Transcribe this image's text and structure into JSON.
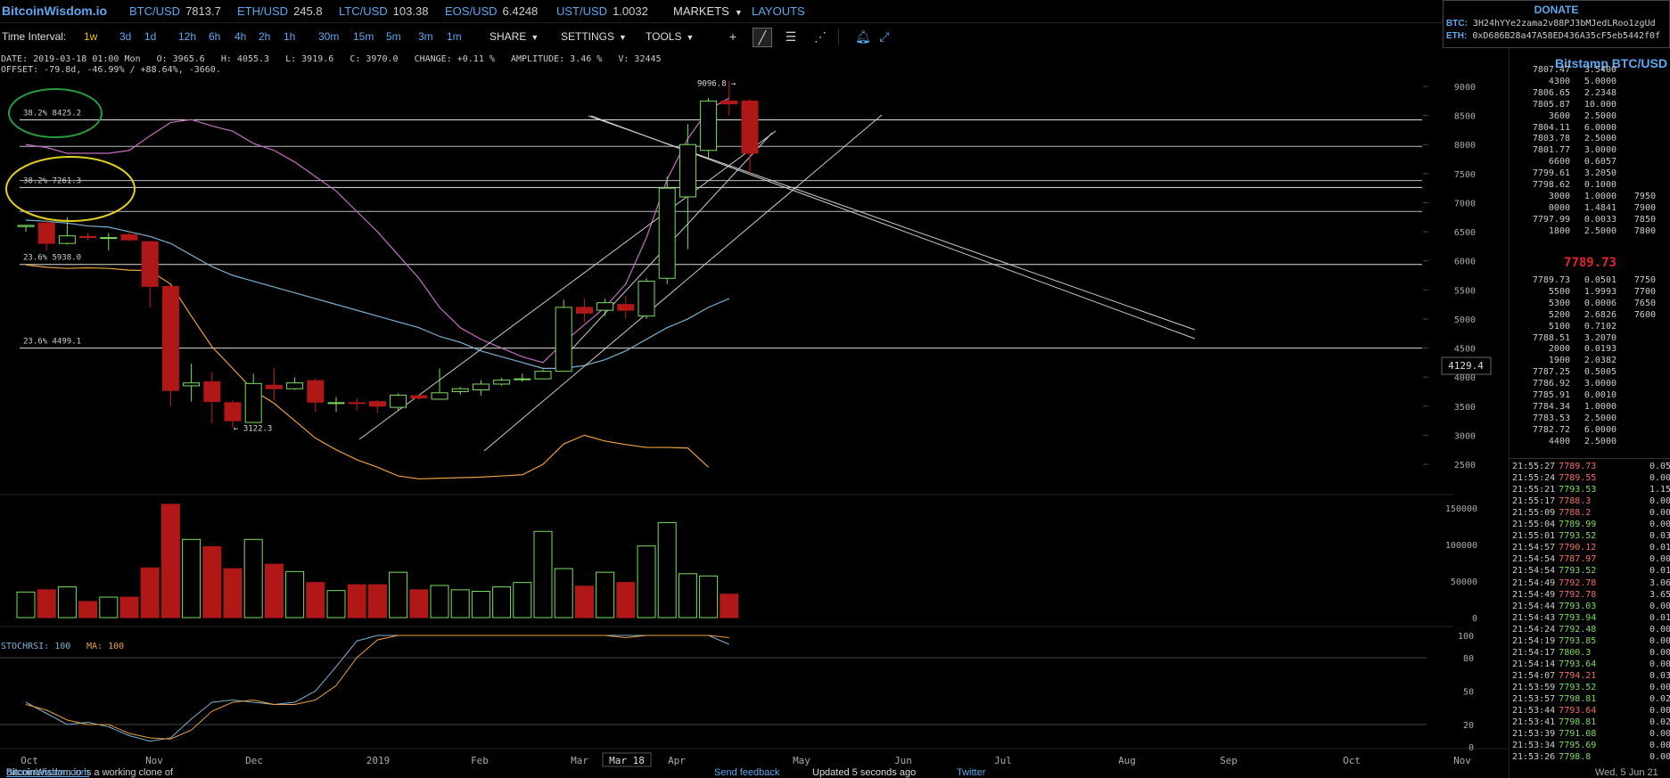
{
  "brand": "BitcoinWisdom.io",
  "tickers": [
    {
      "pair": "BTC/USD",
      "value": "7813.7"
    },
    {
      "pair": "ETH/USD",
      "value": "245.8"
    },
    {
      "pair": "LTC/USD",
      "value": "103.38"
    },
    {
      "pair": "EOS/USD",
      "value": "6.4248"
    },
    {
      "pair": "UST/USD",
      "value": "1.0032"
    }
  ],
  "nav": {
    "markets": "MARKETS",
    "layouts": "LAYOUTS"
  },
  "donate": {
    "title": "DONATE",
    "btc_label": "BTC:",
    "btc_addr": "3H24hYYe2zama2v88PJ3bMJedLRoo1zgUd",
    "eth_label": "ETH:",
    "eth_addr": "0xD686B28a47A58ED436A35cF5eb5442f0f"
  },
  "toolbar": {
    "interval_label": "Time Interval:",
    "intervals": [
      "1w",
      "3d",
      "1d",
      "12h",
      "6h",
      "4h",
      "2h",
      "1h",
      "30m",
      "15m",
      "5m",
      "3m",
      "1m"
    ],
    "active_interval": "1w",
    "share": "SHARE",
    "settings": "SETTINGS",
    "tools": "TOOLS"
  },
  "info": {
    "line1": "DATE: 2019-03-18 01:00 Mon   O: 3965.6   H: 4055.3   L: 3919.6   C: 3970.0   CHANGE: +0.11 %   AMPLITUDE: 3.46 %   V: 32445",
    "line2": "OFFSET: -79.8d, -46.99% / +88.64%, -3660."
  },
  "chart_data": {
    "type": "candlestick",
    "price_axis": [
      9000,
      8500,
      8000,
      7500,
      7000,
      6500,
      6000,
      5500,
      5000,
      4500,
      4000,
      3500,
      3000,
      2500
    ],
    "ylim": [
      2250,
      9350
    ],
    "months": [
      "Oct",
      "Nov",
      "Dec",
      "2019",
      "Feb",
      "Mar",
      "Mar 18",
      "Apr",
      "May",
      "Jun",
      "Jul",
      "Aug",
      "Sep",
      "Oct",
      "Nov"
    ],
    "candles": [
      {
        "o": 6590,
        "h": 6620,
        "l": 6500,
        "c": 6610
      },
      {
        "o": 6650,
        "h": 6720,
        "l": 6180,
        "c": 6300
      },
      {
        "o": 6300,
        "h": 6750,
        "l": 6280,
        "c": 6430
      },
      {
        "o": 6420,
        "h": 6480,
        "l": 6350,
        "c": 6400
      },
      {
        "o": 6400,
        "h": 6480,
        "l": 6180,
        "c": 6400
      },
      {
        "o": 6450,
        "h": 6500,
        "l": 6340,
        "c": 6360
      },
      {
        "o": 6330,
        "h": 6340,
        "l": 5200,
        "c": 5560
      },
      {
        "o": 5560,
        "h": 5580,
        "l": 3500,
        "c": 3770
      },
      {
        "o": 3850,
        "h": 4230,
        "l": 3580,
        "c": 3900
      },
      {
        "o": 3920,
        "h": 4080,
        "l": 3200,
        "c": 3580
      },
      {
        "o": 3560,
        "h": 3600,
        "l": 3130,
        "c": 3250
      },
      {
        "o": 3220,
        "h": 4060,
        "l": 3220,
        "c": 3890
      },
      {
        "o": 3860,
        "h": 4150,
        "l": 3600,
        "c": 3800
      },
      {
        "o": 3800,
        "h": 4000,
        "l": 3780,
        "c": 3900
      },
      {
        "o": 3940,
        "h": 3980,
        "l": 3400,
        "c": 3570
      },
      {
        "o": 3550,
        "h": 3660,
        "l": 3400,
        "c": 3560
      },
      {
        "o": 3560,
        "h": 3640,
        "l": 3420,
        "c": 3550
      },
      {
        "o": 3580,
        "h": 3600,
        "l": 3380,
        "c": 3500
      },
      {
        "o": 3480,
        "h": 3720,
        "l": 3420,
        "c": 3690
      },
      {
        "o": 3680,
        "h": 3700,
        "l": 3600,
        "c": 3640
      },
      {
        "o": 3620,
        "h": 4150,
        "l": 3620,
        "c": 3730
      },
      {
        "o": 3750,
        "h": 3830,
        "l": 3700,
        "c": 3800
      },
      {
        "o": 3780,
        "h": 3950,
        "l": 3680,
        "c": 3880
      },
      {
        "o": 3880,
        "h": 3990,
        "l": 3850,
        "c": 3950
      },
      {
        "o": 3960,
        "h": 4060,
        "l": 3920,
        "c": 3970
      },
      {
        "o": 3970,
        "h": 4130,
        "l": 3960,
        "c": 4100
      },
      {
        "o": 4100,
        "h": 5330,
        "l": 4100,
        "c": 5200
      },
      {
        "o": 5200,
        "h": 5350,
        "l": 4950,
        "c": 5100
      },
      {
        "o": 5150,
        "h": 5350,
        "l": 5050,
        "c": 5280
      },
      {
        "o": 5250,
        "h": 5400,
        "l": 5000,
        "c": 5150
      },
      {
        "o": 5050,
        "h": 5700,
        "l": 5000,
        "c": 5650
      },
      {
        "o": 5700,
        "h": 7450,
        "l": 5600,
        "c": 7250
      },
      {
        "o": 7100,
        "h": 8350,
        "l": 6200,
        "c": 8000
      },
      {
        "o": 7900,
        "h": 8800,
        "l": 7750,
        "c": 8750
      },
      {
        "o": 8750,
        "h": 9096.8,
        "l": 8500,
        "c": 8700
      },
      {
        "o": 8750,
        "h": 8780,
        "l": 7500,
        "c": 7850
      }
    ],
    "volumes": [
      35000,
      38000,
      42000,
      22000,
      28000,
      28000,
      68000,
      155000,
      107000,
      97000,
      67000,
      107000,
      73000,
      63000,
      48000,
      37000,
      45000,
      45000,
      62000,
      38000,
      44000,
      38000,
      36000,
      42000,
      48000,
      118000,
      67000,
      43000,
      62000,
      48000,
      98000,
      130000,
      60000,
      57000,
      32000,
      0
    ],
    "volume_axis": [
      150000,
      100000,
      50000,
      0
    ],
    "fib_levels": [
      {
        "label": "38.2% 8425.2",
        "price": 8425.2
      },
      {
        "label": "38.2% 7261.3",
        "price": 7261.3
      },
      {
        "label": "23.6% 5938.0",
        "price": 5938.0
      },
      {
        "label": "23.6% 4499.1",
        "price": 4499.1
      }
    ],
    "extra_hlines": [
      7970,
      7380,
      6850
    ],
    "high_label": "9096.8 →",
    "low_label": "← 3122.3",
    "cursor_price": "4129.4",
    "stochrsi": {
      "label": "STOCHRSI: 100",
      "ma_label": "MA: 100",
      "axis": [
        100,
        80,
        50,
        20,
        0
      ],
      "k": [
        40,
        30,
        20,
        22,
        18,
        10,
        5,
        8,
        25,
        40,
        42,
        40,
        38,
        40,
        50,
        72,
        95,
        100,
        100,
        100,
        100,
        100,
        100,
        100,
        100,
        100,
        100,
        100,
        100,
        100,
        100,
        100,
        100,
        100,
        92
      ],
      "d": [
        38,
        33,
        24,
        20,
        20,
        12,
        8,
        7,
        15,
        32,
        40,
        42,
        38,
        38,
        42,
        55,
        80,
        96,
        100,
        100,
        100,
        100,
        100,
        100,
        100,
        100,
        100,
        100,
        100,
        98,
        100,
        100,
        100,
        100,
        98
      ]
    }
  },
  "panel": {
    "title": "Bitstamp BTC/USD",
    "asks": [
      {
        "p": "7807.47",
        "a": "3.5400"
      },
      {
        "p": "4300",
        "a": "5.0000"
      },
      {
        "p": "7806.65",
        "a": "2.2348"
      },
      {
        "p": "7805.87",
        "a": "10.000"
      },
      {
        "p": "3600",
        "a": "2.5000"
      },
      {
        "p": "7804.11",
        "a": "6.0000"
      },
      {
        "p": "7803.78",
        "a": "2.5000"
      },
      {
        "p": "7801.77",
        "a": "3.0000"
      },
      {
        "p": "6600",
        "a": "0.6057"
      },
      {
        "p": "7799.61",
        "a": "3.2050"
      },
      {
        "p": "7798.62",
        "a": "0.1000"
      },
      {
        "p": "3000",
        "a": "1.0000",
        "d": "7950"
      },
      {
        "p": "0000",
        "a": "1.4841",
        "d": "7900"
      },
      {
        "p": "7797.99",
        "a": "0.0033",
        "d": "7850"
      },
      {
        "p": "1800",
        "a": "2.5000",
        "d": "7800"
      }
    ],
    "last_price": "7789.73",
    "bids": [
      {
        "p": "7789.73",
        "a": "0.0501",
        "d": "7750"
      },
      {
        "p": "5500",
        "a": "1.9993",
        "d": "7700"
      },
      {
        "p": "5300",
        "a": "0.0006",
        "d": "7650"
      },
      {
        "p": "5200",
        "a": "2.6826",
        "d": "7600"
      },
      {
        "p": "5100",
        "a": "0.7102"
      },
      {
        "p": "7788.51",
        "a": "3.2070"
      },
      {
        "p": "2000",
        "a": "0.0193"
      },
      {
        "p": "1900",
        "a": "2.0382"
      },
      {
        "p": "7787.25",
        "a": "0.5005"
      },
      {
        "p": "7786.92",
        "a": "3.0000"
      },
      {
        "p": "7785.91",
        "a": "0.0010"
      },
      {
        "p": "7784.34",
        "a": "1.0000"
      },
      {
        "p": "7783.53",
        "a": "2.5000"
      },
      {
        "p": "7782.72",
        "a": "6.0000"
      },
      {
        "p": "4400",
        "a": "2.5000"
      }
    ],
    "trades": [
      {
        "t": "21:55:27",
        "p": "7789.73",
        "a": "0.05",
        "dir": "dn"
      },
      {
        "t": "21:55:24",
        "p": "7789.55",
        "a": "0.00",
        "dir": "dn"
      },
      {
        "t": "21:55:21",
        "p": "7793.53",
        "a": "1.15",
        "dir": "up"
      },
      {
        "t": "21:55:17",
        "p": "7788.3",
        "a": "0.00",
        "dir": "dn"
      },
      {
        "t": "21:55:09",
        "p": "7788.2",
        "a": "0.00",
        "dir": "dn"
      },
      {
        "t": "21:55:04",
        "p": "7789.99",
        "a": "0.00",
        "dir": "up"
      },
      {
        "t": "21:55:01",
        "p": "7793.52",
        "a": "0.03",
        "dir": "up"
      },
      {
        "t": "21:54:57",
        "p": "7790.12",
        "a": "0.01",
        "dir": "dn"
      },
      {
        "t": "21:54:54",
        "p": "7787.97",
        "a": "0.00",
        "dir": "dn"
      },
      {
        "t": "21:54:54",
        "p": "7793.52",
        "a": "0.01",
        "dir": "up"
      },
      {
        "t": "21:54:49",
        "p": "7792.78",
        "a": "3.06",
        "dir": "dn"
      },
      {
        "t": "21:54:49",
        "p": "7792.78",
        "a": "3.65",
        "dir": "dn"
      },
      {
        "t": "21:54:44",
        "p": "7793.03",
        "a": "0.00",
        "dir": "up"
      },
      {
        "t": "21:54:43",
        "p": "7793.94",
        "a": "0.01",
        "dir": "up"
      },
      {
        "t": "21:54:24",
        "p": "7792.48",
        "a": "0.00",
        "dir": "up"
      },
      {
        "t": "21:54:19",
        "p": "7793.85",
        "a": "0.00",
        "dir": "up"
      },
      {
        "t": "21:54:17",
        "p": "7800.3",
        "a": "0.00",
        "dir": "up"
      },
      {
        "t": "21:54:14",
        "p": "7793.64",
        "a": "0.00",
        "dir": "up"
      },
      {
        "t": "21:54:07",
        "p": "7794.21",
        "a": "0.03",
        "dir": "dn"
      },
      {
        "t": "21:53:59",
        "p": "7793.52",
        "a": "0.00",
        "dir": "up"
      },
      {
        "t": "21:53:57",
        "p": "7798.81",
        "a": "0.02",
        "dir": "up"
      },
      {
        "t": "21:53:44",
        "p": "7793.64",
        "a": "0.00",
        "dir": "dn"
      },
      {
        "t": "21:53:41",
        "p": "7798.81",
        "a": "0.02",
        "dir": "up"
      },
      {
        "t": "21:53:39",
        "p": "7791.08",
        "a": "0.00",
        "dir": "up"
      },
      {
        "t": "21:53:34",
        "p": "7795.69",
        "a": "0.00",
        "dir": "up"
      },
      {
        "t": "21:53:26",
        "p": "7798.8",
        "a": "0.00",
        "dir": "up"
      }
    ]
  },
  "footer": {
    "left_text": "BitcoinWisdom.io is a working clone of",
    "left_link": "bitcoinwisdom.com",
    "feedback": "Send feedback",
    "updated": "Updated 5 seconds ago",
    "twitter": "Twitter",
    "date": "Wed, 5 Jun 21"
  },
  "colors": {
    "up": "#7ddc5e",
    "down": "#b01818",
    "accent": "#5ba8f0",
    "fib": "#cccccc"
  }
}
